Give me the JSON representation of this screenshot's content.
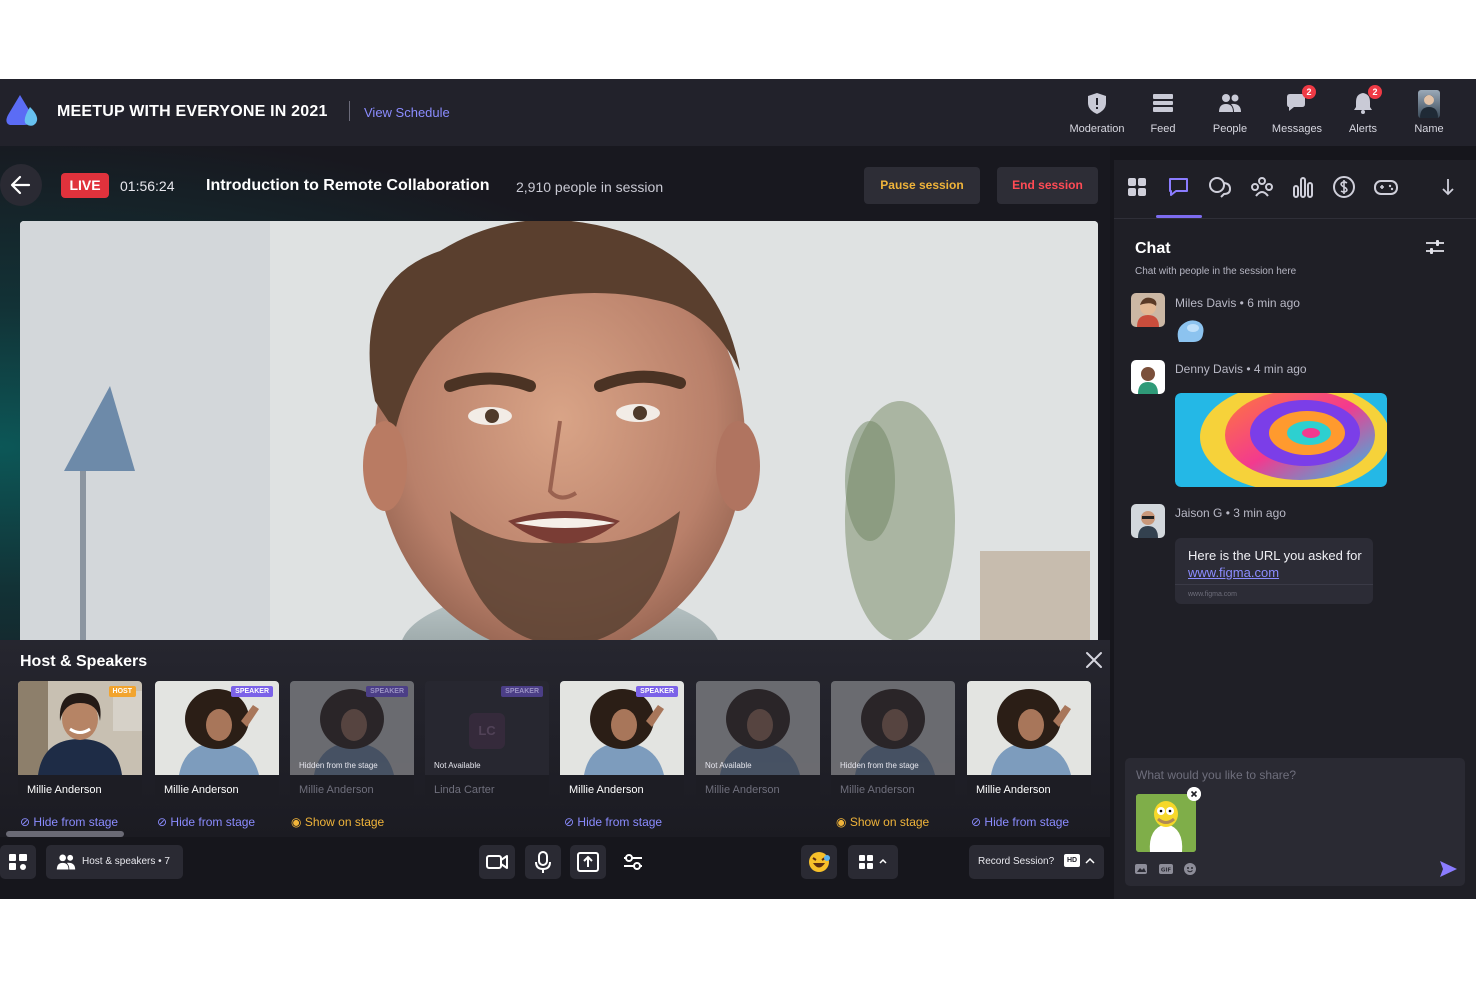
{
  "header": {
    "event_title": "MEETUP WITH EVERYONE IN 2021",
    "view_schedule": "View Schedule",
    "nav": [
      {
        "label": "Moderation",
        "icon": "shield-icon"
      },
      {
        "label": "Feed",
        "icon": "feed-icon"
      },
      {
        "label": "People",
        "icon": "people-icon"
      },
      {
        "label": "Messages",
        "icon": "messages-icon",
        "badge": "2"
      },
      {
        "label": "Alerts",
        "icon": "bell-icon",
        "badge": "2"
      },
      {
        "label": "Name",
        "icon": "profile-avatar"
      }
    ]
  },
  "session": {
    "live_label": "LIVE",
    "timer": "01:56:24",
    "title": "Introduction to Remote Collaboration",
    "people_count": "2,910 people in session",
    "pause_label": "Pause session",
    "end_label": "End session"
  },
  "speakers_panel": {
    "title": "Host & Speakers",
    "cards": [
      {
        "name": "Millie Anderson",
        "tag": "HOST",
        "overlay": "",
        "state": "active",
        "action": "Hide from stage"
      },
      {
        "name": "Millie Anderson",
        "tag": "SPEAKER",
        "overlay": "",
        "state": "active",
        "action": "Hide from stage"
      },
      {
        "name": "Millie Anderson",
        "tag": "SPEAKER",
        "overlay": "Hidden from the stage",
        "state": "hidden",
        "action": "Show on stage"
      },
      {
        "name": "Linda Carter",
        "tag": "SPEAKER",
        "overlay": "Not Available",
        "state": "unavailable",
        "initials": "LC",
        "action": ""
      },
      {
        "name": "Millie Anderson",
        "tag": "SPEAKER",
        "overlay": "",
        "state": "active",
        "action": "Hide from stage"
      },
      {
        "name": "Millie Anderson",
        "tag": "",
        "overlay": "Not Available",
        "state": "unavailable",
        "action": ""
      },
      {
        "name": "Millie Anderson",
        "tag": "",
        "overlay": "Hidden from the stage",
        "state": "hidden",
        "action": "Show on stage"
      },
      {
        "name": "Millie Anderson",
        "tag": "",
        "overlay": "",
        "state": "active",
        "action": "Hide from stage"
      }
    ]
  },
  "controls": {
    "hosts_label": "Host & speakers • 7",
    "record_label": "Record Session?",
    "hd_badge": "HD"
  },
  "sidebar": {
    "tabs": [
      "grid-icon",
      "chat-icon",
      "qa-icon",
      "group-icon",
      "poll-icon",
      "dollar-icon",
      "gamepad-icon",
      "arrow-down-icon"
    ],
    "chat_title": "Chat",
    "chat_subtitle": "Chat with people in the session here",
    "messages": [
      {
        "meta": "Miles Davis • 6 min ago",
        "type": "sticker"
      },
      {
        "meta": "Denny Davis • 4 min ago",
        "type": "image"
      },
      {
        "meta": "Jaison G • 3 min ago",
        "type": "link",
        "text": "Here is the URL you asked for",
        "link": "www.figma.com",
        "url_preview": "www.figma.com"
      }
    ],
    "composer_placeholder": "What would you like to share?"
  },
  "colors": {
    "accent": "#7d6cf0",
    "live": "#e0323c",
    "warning": "#f0b43a",
    "danger": "#ff4b55",
    "link": "#8b8cff"
  }
}
